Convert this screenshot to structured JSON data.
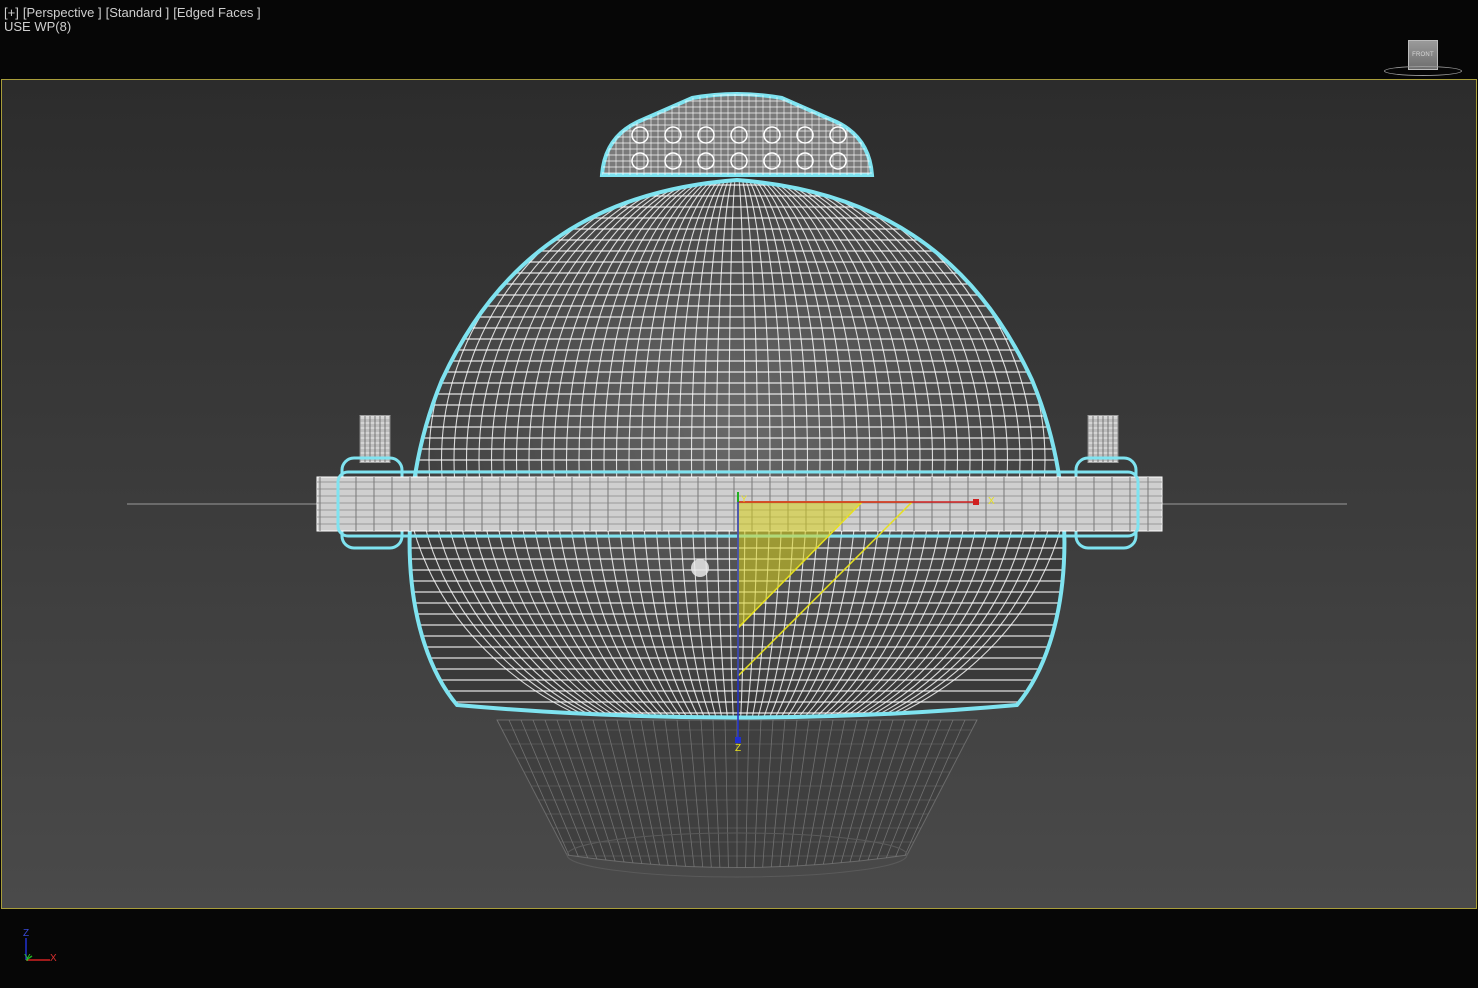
{
  "viewport": {
    "labels": [
      "[+]",
      "[Perspective ]",
      "[Standard ]",
      "[Edged Faces ]"
    ],
    "workplane_label": "USE WP(8)"
  },
  "viewcube": {
    "face_label": "FRONT"
  },
  "gizmo": {
    "x_label": "X",
    "y_label": "Y",
    "z_label": "Z"
  },
  "axis_tripod": {
    "z_label": "Z",
    "y_label": "Y",
    "x_label": "X"
  },
  "colors": {
    "background_top": "#2c2c2c",
    "background_bottom": "#4a4a4a",
    "safe_frame": "#a89d3a",
    "selection_outline": "#7fe3f0",
    "wireframe": "#ffffff",
    "gizmo_plane": "#d9d21a",
    "axis_x": "#d02020",
    "axis_y": "#20b020",
    "axis_z": "#2030d0"
  }
}
